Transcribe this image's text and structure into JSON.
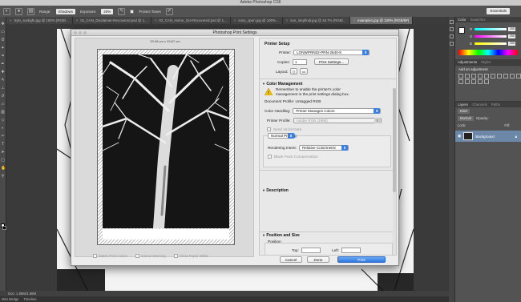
{
  "app": {
    "title": "Adobe Photoshop CS6"
  },
  "options_bar": {
    "range_label": "Range:",
    "range_value": "Shadows",
    "exposure_label": "Exposure:",
    "exposure_value": "20%",
    "protect_tones_label": "Protect Tones",
    "workspace": "Essentials"
  },
  "tabs": [
    {
      "label": "trylo_sunlight.jpg @ 100% (RGB/..."
    },
    {
      "label": "01_CAN_Disclaimer-Recovered.psd @ 1..."
    },
    {
      "label": "02_CAN_Home_2x4-Recovered.psd @ 1..."
    },
    {
      "label": "sony_open.jpg @ 100%..."
    },
    {
      "label": "sun_stepfinal.jpg @ 16.7% (RGB/..."
    },
    {
      "label": "example1.jpg @ 100% (RGB/8#)"
    }
  ],
  "status_bar": {
    "doc_info": "Doc: 1.98M/1.98M"
  },
  "bottom_tabs": [
    "Mini Bridge",
    "Timeline"
  ],
  "panels": {
    "color_tab": "Color",
    "swatches_tab": "Swatches",
    "r_label": "R",
    "g_label": "G",
    "b_label": "B",
    "r_value": "255",
    "g_value": "255",
    "b_value": "255",
    "adjustments_tab": "Adjustments",
    "styles_tab": "Styles",
    "add_adjustment": "Add an adjustment",
    "layers_tab": "Layers",
    "channels_tab": "Channels",
    "paths_tab": "Paths",
    "kind_label": "Kind",
    "blend_mode": "Normal",
    "opacity_label": "Opacity:",
    "lock_label": "Lock:",
    "fill_label": "Fill:",
    "layer_name": "Background"
  },
  "dialog": {
    "title": "Photoshop Print Settings",
    "paper_size": "20.98 cm x 29.67 cm",
    "match_print_colors": "Match Print Colors",
    "gamut_warning": "Gamut Warning",
    "show_paper_white": "Show Paper White",
    "printer_setup_title": "Printer Setup",
    "printer_label": "Printer:",
    "printer_value": "LONWPRN02-PRN-2640-9",
    "copies_label": "Copies:",
    "copies_value": "1",
    "print_settings_btn": "Print Settings...",
    "layout_label": "Layout:",
    "color_mgmt_title": "Color Management",
    "warning_text_1": "Remember to enable the printer's color",
    "warning_text_2": "management in the print settings dialog box.",
    "doc_profile": "Document Profile: Untagged RGB",
    "color_handling_label": "Color Handling:",
    "color_handling_value": "Printer Manages Colors",
    "printer_profile_label": "Printer Profile:",
    "printer_profile_value": "Adobe RGB (1998)",
    "send16_label": "Send 16-bit Data",
    "normal_printing": "Normal Printing",
    "rendering_intent_label": "Rendering Intent:",
    "rendering_intent_value": "Relative Colorimetric",
    "black_point_label": "Black Point Compensation",
    "description_title": "Description",
    "position_size_title": "Position and Size",
    "position_label": "Position",
    "top_label": "Top:",
    "left_label": "Left:",
    "cancel_btn": "Cancel",
    "done_btn": "Done",
    "print_btn": "Print"
  }
}
